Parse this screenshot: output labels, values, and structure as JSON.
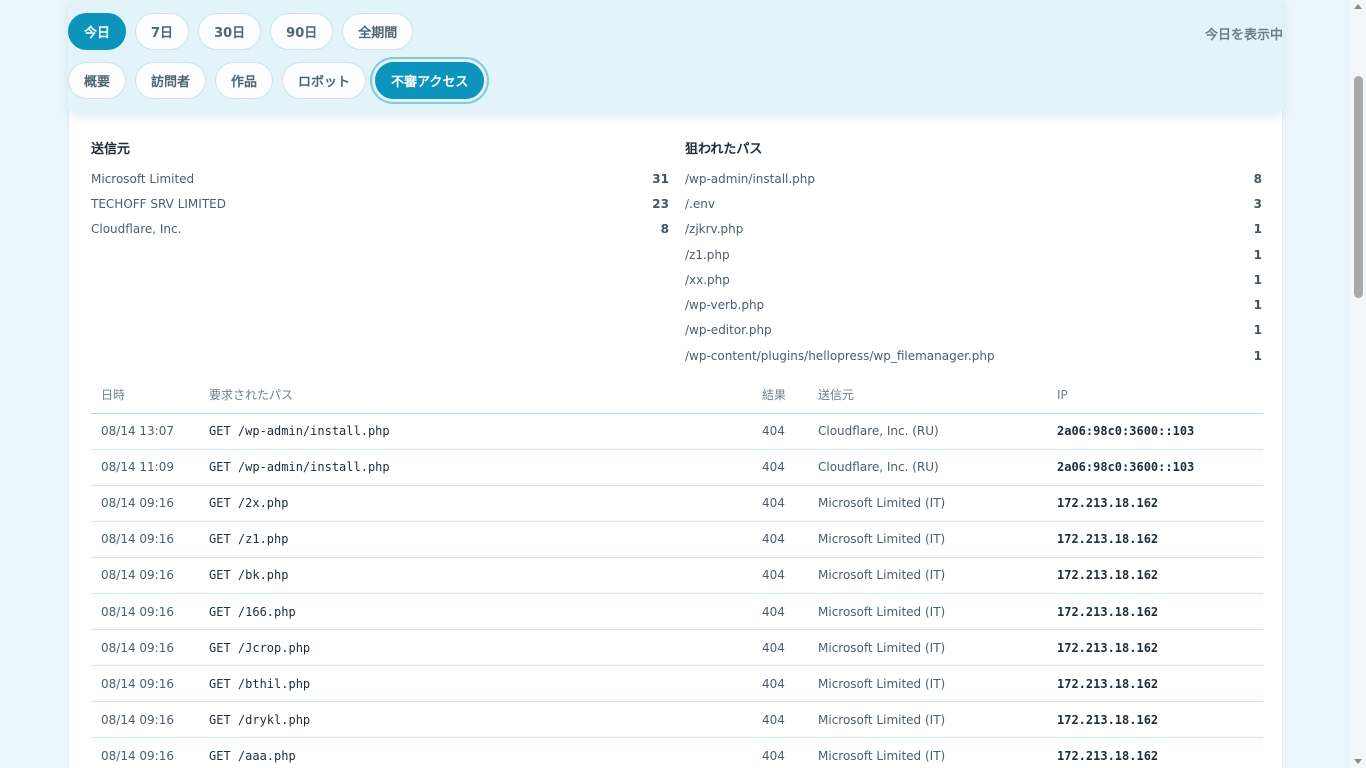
{
  "range_tabs": [
    {
      "label": "今日",
      "active": true
    },
    {
      "label": "7日",
      "active": false
    },
    {
      "label": "30日",
      "active": false
    },
    {
      "label": "90日",
      "active": false
    },
    {
      "label": "全期間",
      "active": false
    }
  ],
  "status_text": "今日を表示中",
  "view_tabs": [
    {
      "label": "概要",
      "active": false
    },
    {
      "label": "訪問者",
      "active": false
    },
    {
      "label": "作品",
      "active": false
    },
    {
      "label": "ロボット",
      "active": false
    },
    {
      "label": "不審アクセス",
      "active": true
    }
  ],
  "sources": {
    "title": "送信元",
    "items": [
      {
        "name": "Microsoft Limited",
        "count": "31"
      },
      {
        "name": "TECHOFF SRV LIMITED",
        "count": "23"
      },
      {
        "name": "Cloudflare, Inc.",
        "count": "8"
      }
    ]
  },
  "paths": {
    "title": "狙われたパス",
    "items": [
      {
        "name": "/wp-admin/install.php",
        "count": "8"
      },
      {
        "name": "/.env",
        "count": "3"
      },
      {
        "name": "/zjkrv.php",
        "count": "1"
      },
      {
        "name": "/z1.php",
        "count": "1"
      },
      {
        "name": "/xx.php",
        "count": "1"
      },
      {
        "name": "/wp-verb.php",
        "count": "1"
      },
      {
        "name": "/wp-editor.php",
        "count": "1"
      },
      {
        "name": "/wp-content/plugins/hellopress/wp_filemanager.php",
        "count": "1"
      }
    ]
  },
  "log_table": {
    "headers": {
      "datetime": "日時",
      "path": "要求されたパス",
      "result": "結果",
      "source": "送信元",
      "ip": "IP"
    },
    "rows": [
      {
        "datetime": "08/14 13:07",
        "request": "GET /wp-admin/install.php",
        "result": "404",
        "source": "Cloudflare, Inc. (RU)",
        "ip": "2a06:98c0:3600::103"
      },
      {
        "datetime": "08/14 11:09",
        "request": "GET /wp-admin/install.php",
        "result": "404",
        "source": "Cloudflare, Inc. (RU)",
        "ip": "2a06:98c0:3600::103"
      },
      {
        "datetime": "08/14 09:16",
        "request": "GET /2x.php",
        "result": "404",
        "source": "Microsoft Limited (IT)",
        "ip": "172.213.18.162"
      },
      {
        "datetime": "08/14 09:16",
        "request": "GET /z1.php",
        "result": "404",
        "source": "Microsoft Limited (IT)",
        "ip": "172.213.18.162"
      },
      {
        "datetime": "08/14 09:16",
        "request": "GET /bk.php",
        "result": "404",
        "source": "Microsoft Limited (IT)",
        "ip": "172.213.18.162"
      },
      {
        "datetime": "08/14 09:16",
        "request": "GET /166.php",
        "result": "404",
        "source": "Microsoft Limited (IT)",
        "ip": "172.213.18.162"
      },
      {
        "datetime": "08/14 09:16",
        "request": "GET /Jcrop.php",
        "result": "404",
        "source": "Microsoft Limited (IT)",
        "ip": "172.213.18.162"
      },
      {
        "datetime": "08/14 09:16",
        "request": "GET /bthil.php",
        "result": "404",
        "source": "Microsoft Limited (IT)",
        "ip": "172.213.18.162"
      },
      {
        "datetime": "08/14 09:16",
        "request": "GET /drykl.php",
        "result": "404",
        "source": "Microsoft Limited (IT)",
        "ip": "172.213.18.162"
      },
      {
        "datetime": "08/14 09:16",
        "request": "GET /aaa.php",
        "result": "404",
        "source": "Microsoft Limited (IT)",
        "ip": "172.213.18.162"
      }
    ]
  },
  "colors": {
    "accent": "#0c94bd",
    "background": "#eaf6fb"
  }
}
